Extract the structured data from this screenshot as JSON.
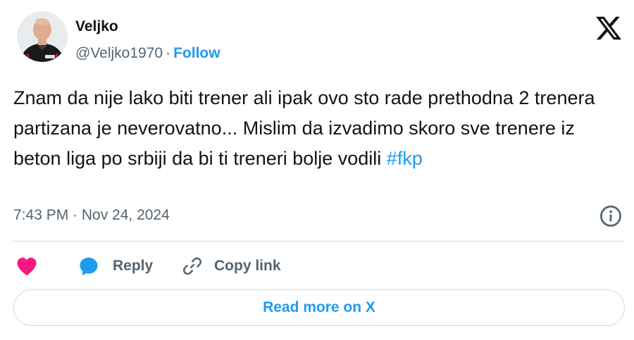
{
  "author": {
    "name": "Veljko",
    "handle": "@Veljko1970",
    "separator": "·",
    "follow_label": "Follow"
  },
  "tweet": {
    "text": "Znam da nije lako biti trener ali ipak ovo sto rade prethodna 2 trenera partizana je neverovatno... Mislim da izvadimo skoro sve trenere iz beton liga po srbiji da bi ti treneri bolje vodili ",
    "hashtag": "#fkp",
    "timestamp": "7:43 PM · Nov 24, 2024"
  },
  "actions": {
    "like_icon": "heart-icon",
    "reply_icon": "speech-bubble-icon",
    "reply_label": "Reply",
    "copy_icon": "link-icon",
    "copy_label": "Copy link"
  },
  "read_more_label": "Read more on X",
  "colors": {
    "accent": "#1d9bf0",
    "like": "#f91880",
    "secondary_text": "#536471",
    "primary_text": "#0f1419",
    "border": "#cfd9de"
  },
  "icons": {
    "brand": "x-logo-icon",
    "info": "info-icon",
    "avatar": "avatar"
  }
}
